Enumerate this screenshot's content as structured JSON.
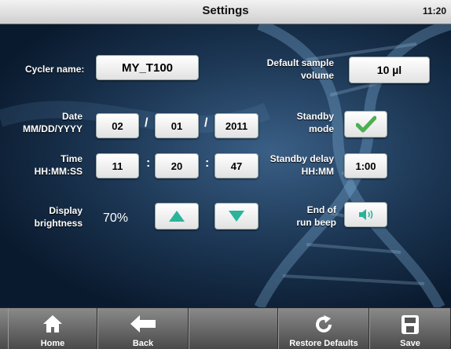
{
  "header": {
    "title": "Settings",
    "time": "11:20"
  },
  "form": {
    "cycler_name": {
      "label": "Cycler name:",
      "value": "MY_T100"
    },
    "sample_volume": {
      "label_line1": "Default sample",
      "label_line2": "volume",
      "value": "10 µl"
    },
    "date": {
      "label_line1": "Date",
      "label_line2": "MM/DD/YYYY",
      "month": "02",
      "day": "01",
      "year": "2011",
      "sep": "/"
    },
    "standby_mode": {
      "label_line1": "Standby",
      "label_line2": "mode",
      "icon": "checkmark-icon",
      "checked": true
    },
    "time": {
      "label_line1": "Time",
      "label_line2": "HH:MM:SS",
      "hh": "11",
      "mm": "20",
      "ss": "47",
      "sep": ":"
    },
    "standby_delay": {
      "label_line1": "Standby delay",
      "label_line2": "HH:MM",
      "value": "1:00"
    },
    "brightness": {
      "label_line1": "Display",
      "label_line2": "brightness",
      "value": "70%",
      "up_icon": "arrow-up-icon",
      "down_icon": "arrow-down-icon"
    },
    "run_beep": {
      "label_line1": "End of",
      "label_line2": "run beep",
      "icon": "speaker-icon"
    }
  },
  "toolbar": {
    "home": "Home",
    "back": "Back",
    "restore": "Restore Defaults",
    "save": "Save"
  },
  "colors": {
    "accent_teal": "#2bb39b",
    "check_green": "#4caf50"
  }
}
